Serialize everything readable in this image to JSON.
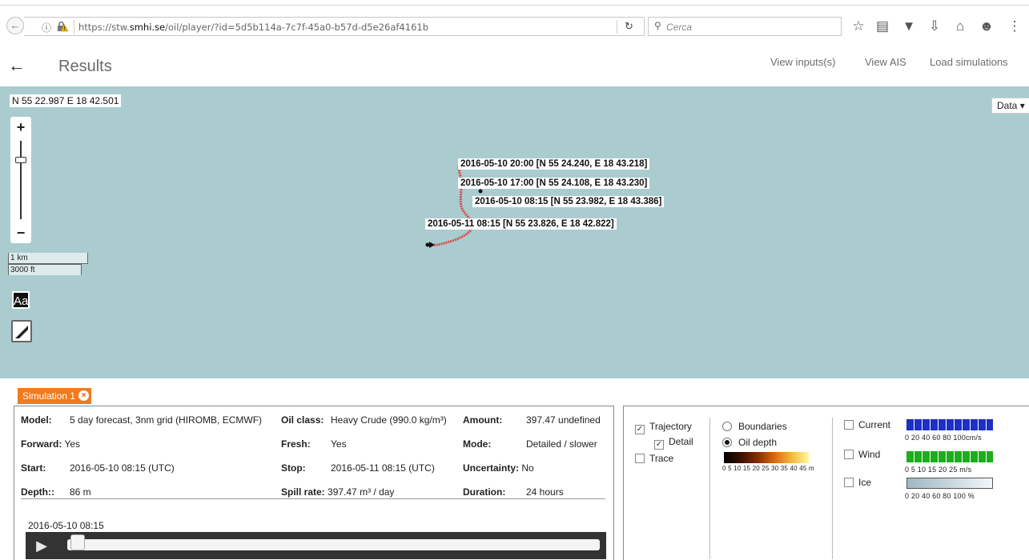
{
  "browser": {
    "url_prefix": "https://stw.",
    "url_domain": "smhi.se",
    "url_path": "/oil/player/?id=5d5b114a-7c7f-45a0-b57d-d5e26af4161b",
    "search_placeholder": "Cerca"
  },
  "header": {
    "title": "Results",
    "nav": [
      "View inputs(s)",
      "View AIS",
      "Load simulations"
    ]
  },
  "map": {
    "cursor_coord": "N 55 22.987 E 18 42.501",
    "layer_select": "Data",
    "scale_km": "1 km",
    "scale_ft": "3000 ft",
    "text_tool": "Aa",
    "labels": [
      "2016-05-10 20:00 [N 55 24.240, E 18 43.218]",
      "2016-05-10 17:00 [N 55 24.108, E 18 43.230]",
      "2016-05-10 08:15 [N 55 23.982, E 18 43.386]",
      "2016-05-11 08:15 [N 55 23.826, E 18 42.822]"
    ]
  },
  "simulation": {
    "tab_label": "Simulation 1",
    "model_label": "Model:",
    "model": "5 day forecast, 3nm grid (HIROMB, ECMWF)",
    "oil_class_label": "Oil class:",
    "oil_class": "Heavy Crude (990.0 kg/m³)",
    "amount_label": "Amount:",
    "amount": "397.47 undefined",
    "forward_label": "Forward:",
    "forward": "Yes",
    "fresh_label": "Fresh:",
    "fresh": "Yes",
    "mode_label": "Mode:",
    "mode": "Detailed / slower",
    "start_label": "Start:",
    "start": "2016-05-10 08:15 (UTC)",
    "stop_label": "Stop:",
    "stop": "2016-05-11 08:15 (UTC)",
    "uncertainty_label": "Uncertainty:",
    "uncertainty": "No",
    "depth_label": "Depth::",
    "depth": "86 m",
    "spill_rate_label": "Spill rate:",
    "spill_rate": "397.47 m³ / day",
    "duration_label": "Duration:",
    "duration": "24 hours",
    "current_time": "2016-05-10 08:15"
  },
  "options": {
    "trajectory": "Trajectory",
    "detail": "Detail",
    "trace": "Trace",
    "boundaries": "Boundaries",
    "oil_depth": "Oil depth",
    "oil_depth_ticks": "0 5 10 15 20 25 30 35 40 45 m",
    "current": "Current",
    "current_ticks": "0   20   40   60   80   100cm/s",
    "wind": "Wind",
    "wind_ticks": "0   5   10   15   20   25  m/s",
    "ice": "Ice",
    "ice_ticks": "0   20   40   60   80   100 %"
  },
  "colors": {
    "tab_orange": "#f07a1d",
    "map_water": "#aacccf",
    "current_bar": "#1d2fc4",
    "wind_bar": "#1cae1c",
    "trajectory": "#d84a4a"
  }
}
